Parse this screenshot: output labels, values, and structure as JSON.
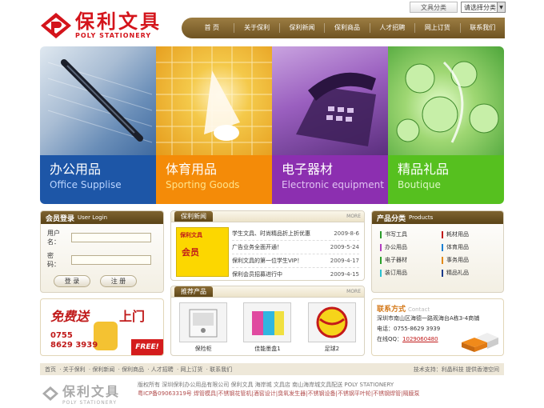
{
  "topbar": {
    "category_button": "文具分类",
    "select_value": "请选择分类"
  },
  "logo": {
    "cn": "保利文具",
    "en": "POLY STATIONERY"
  },
  "nav": [
    "首 页",
    "关于保利",
    "保利新闻",
    "保利商品",
    "人才招聘",
    "网上订货",
    "联系我们"
  ],
  "banner": [
    {
      "cn": "办公用品",
      "en": "Office Supplise"
    },
    {
      "cn": "体育用品",
      "en": "Sporting Goods"
    },
    {
      "cn": "电子器材",
      "en": "Electronic equipment"
    },
    {
      "cn": "精品礼品",
      "en": "Boutique"
    }
  ],
  "login": {
    "title": "会员登录",
    "title_en": "User Login",
    "user_label": "用户名：",
    "pass_label": "密　码：",
    "login_btn": "登 录",
    "register_btn": "注 册"
  },
  "promo": {
    "line1": "免费送",
    "line2": "上门",
    "phone1": "0755",
    "phone2": "8629 3939",
    "free": "FREE!"
  },
  "news": {
    "tab": "保利新闻",
    "more": "MORE",
    "thumb_brand": "保利文具",
    "thumb_text": "会员",
    "items": [
      {
        "title": "学生文具、时尚精品折上折优惠",
        "date": "2009-8-6"
      },
      {
        "title": "广告业务全面开通！",
        "date": "2009-5-24"
      },
      {
        "title": "保利文具的第一位学生VIP！",
        "date": "2009-4-17"
      },
      {
        "title": "保利会员招募进行中",
        "date": "2009-4-15"
      }
    ]
  },
  "rec": {
    "tab": "推荐产品",
    "more": "MORE",
    "items": [
      {
        "label": "保险柜"
      },
      {
        "label": "佳能墨盒1"
      },
      {
        "label": "足球2"
      }
    ]
  },
  "cats": {
    "title": "产品分类",
    "title_en": "Products",
    "items": [
      {
        "label": "书写工具",
        "color": "#2a9a2a"
      },
      {
        "label": "耗材用品",
        "color": "#c01a1a"
      },
      {
        "label": "办公用品",
        "color": "#b13cc0"
      },
      {
        "label": "体育用品",
        "color": "#1a7fd4"
      },
      {
        "label": "电子器材",
        "color": "#2aa02a"
      },
      {
        "label": "事务用品",
        "color": "#e28a1a"
      },
      {
        "label": "装订用品",
        "color": "#2ac0d0"
      },
      {
        "label": "精品礼品",
        "color": "#1a3a8a"
      }
    ]
  },
  "contact": {
    "title": "联系方式",
    "title_en": "Contact",
    "address": "深圳市南山区海德一路观海台A栋3-4商铺",
    "phone": "电话：0755-8629 3939",
    "qq_label": "在线QQ：",
    "qq": "1029060480"
  },
  "footer_nav": {
    "links": [
      "首页",
      "关于保利",
      "保利新闻",
      "保利商品",
      "人才招聘",
      "网上订货",
      "联系我们"
    ],
    "right": "技术支持：利晶科技 提供香港空间"
  },
  "footer": {
    "logo_cn": "保利文具",
    "logo_en": "POLY STATIONERY",
    "line1": "版权所有 深圳保利办公用品有限公司 保利文具 海岸城 文具店 南山海岸城文具配送 POLY STATIONERY",
    "line2": "粤ICP备09063319号 焊管模具|不锈钢花管机|酒窖设计|臭氧发生器|不锈钢设备|不锈钢平叶轮|不锈钢焊管|隔膜泵"
  }
}
